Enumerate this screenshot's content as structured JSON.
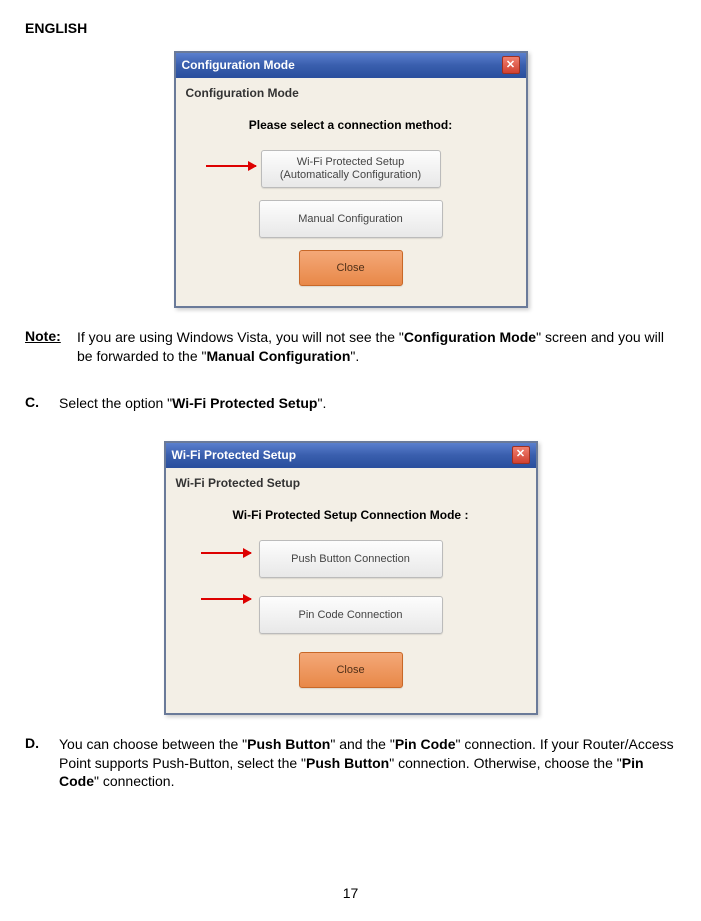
{
  "header": "ENGLISH",
  "dialog1": {
    "title": "Configuration Mode",
    "subtitle": "Configuration Mode",
    "prompt": "Please select a connection method:",
    "btn1_line1": "Wi-Fi Protected Setup",
    "btn1_line2": "(Automatically Configuration)",
    "btn2": "Manual Configuration",
    "close": "Close"
  },
  "note": {
    "label": "Note:",
    "pre": "If you are using Windows Vista, you will not see the \"",
    "bold1": "Configuration Mode",
    "mid": "\" screen and you will be forwarded to the \"",
    "bold2": "Manual Configuration",
    "post": "\"."
  },
  "stepC": {
    "letter": "C.",
    "pre": "Select the option \"",
    "bold": "Wi-Fi Protected Setup",
    "post": "\"."
  },
  "dialog2": {
    "title": "Wi-Fi Protected Setup",
    "subtitle": "Wi-Fi Protected Setup",
    "prompt": "Wi-Fi Protected Setup Connection  Mode :",
    "btn1": "Push Button Connection",
    "btn2": "Pin Code Connection",
    "close": "Close"
  },
  "stepD": {
    "letter": "D.",
    "t1": "You can choose between the \"",
    "b1": "Push Button",
    "t2": "\" and the \"",
    "b2": "Pin Code",
    "t3": "\" connection. If your Router/Access Point supports Push-Button, select the \"",
    "b3": "Push Button",
    "t4": "\" connection. Otherwise, choose the \"",
    "b4": "Pin Code",
    "t5": "\" connection."
  },
  "pageNumber": "17"
}
